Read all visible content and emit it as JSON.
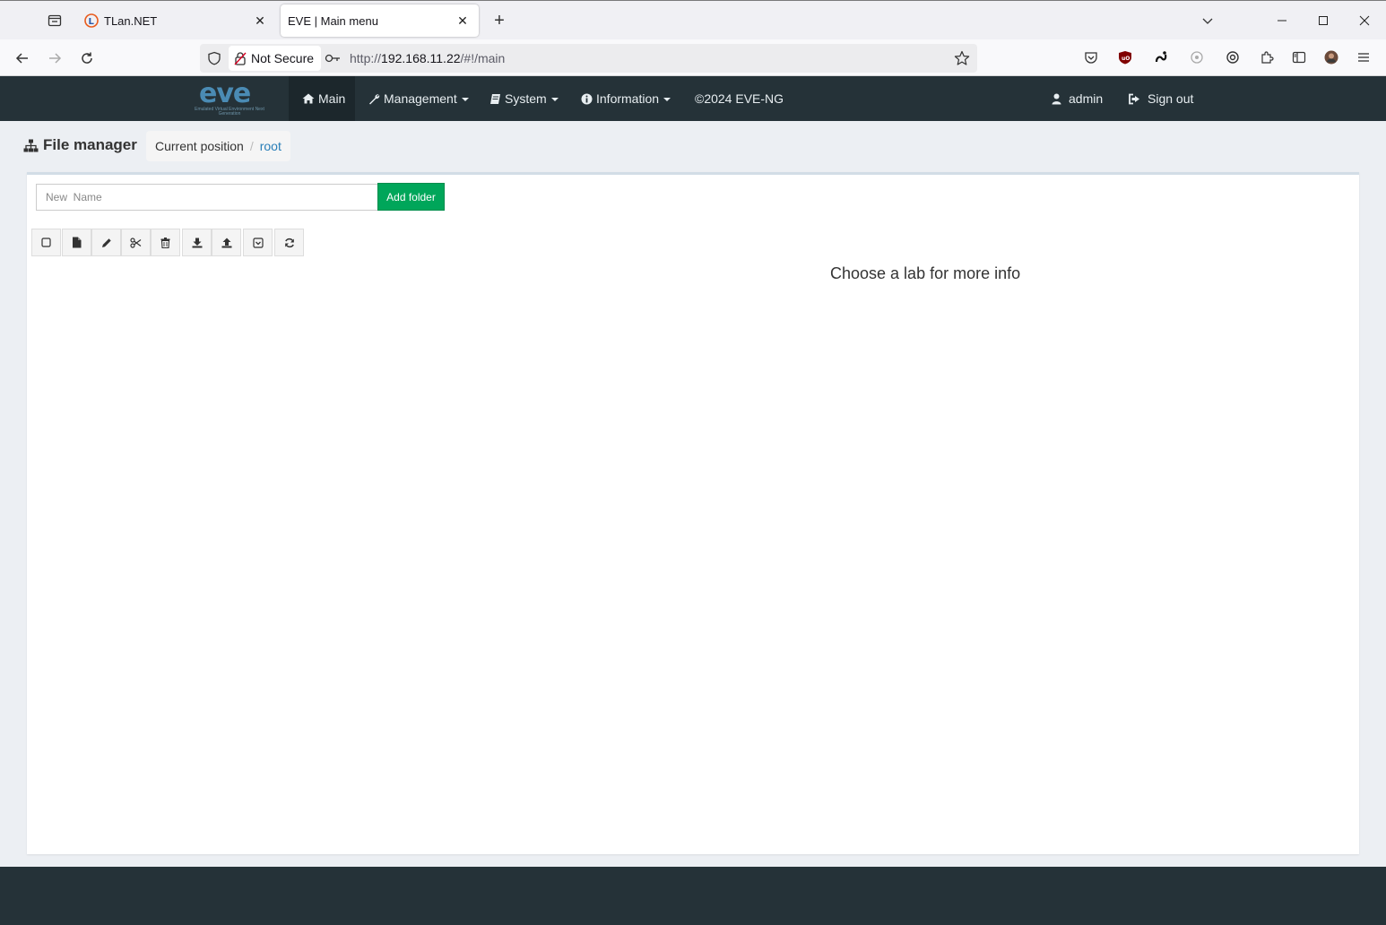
{
  "browser": {
    "tabs": [
      {
        "title": "TLan.NET",
        "favicon": "tlan-icon",
        "active": false
      },
      {
        "title": "EVE | Main menu",
        "favicon": "",
        "active": true
      }
    ],
    "address": {
      "security_label": "Not Secure",
      "url_prefix": "http://",
      "url_host": "192.168.11.22",
      "url_path": "/#!/main"
    }
  },
  "app": {
    "logo_text": "eve",
    "logo_subtext": "Emulated Virtual Environment Next Generation",
    "nav": {
      "main": "Main",
      "management": "Management",
      "system": "System",
      "information": "Information",
      "copyright": "©2024 EVE-NG",
      "user": "admin",
      "sign_out": "Sign out"
    },
    "file_manager": {
      "title": "File manager",
      "breadcrumb_label": "Current position",
      "breadcrumb_current": "root",
      "new_name_placeholder": "New  Name",
      "add_folder_label": "Add folder",
      "toolbar_icons": [
        "select-all-icon",
        "new-file-icon",
        "edit-icon",
        "cut-icon",
        "delete-icon",
        "import-icon",
        "export-icon",
        "archive-icon",
        "refresh-icon"
      ]
    },
    "lab_info_text": "Choose a lab for more info"
  },
  "colors": {
    "app_nav_bg": "#253238",
    "add_folder_green": "#00a65a",
    "link_blue": "#2a7fb8",
    "content_bg": "#eceff3"
  }
}
